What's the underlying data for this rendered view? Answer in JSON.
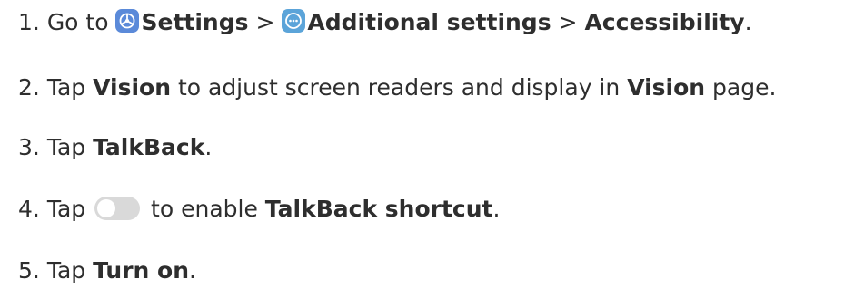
{
  "steps": [
    {
      "number": "1.",
      "parts": {
        "t1": "Go to",
        "settings": "Settings",
        "sep1": ">",
        "additional": "Additional settings",
        "sep2": ">",
        "accessibility": "Accessibility",
        "end": "."
      }
    },
    {
      "number": "2.",
      "parts": {
        "t1": "Tap",
        "vision1": "Vision",
        "t2": "to adjust screen readers and display in",
        "vision2": "Vision",
        "t3": "page."
      }
    },
    {
      "number": "3.",
      "parts": {
        "t1": "Tap",
        "talkback": "TalkBack",
        "end": "."
      }
    },
    {
      "number": "4.",
      "parts": {
        "t1": "Tap",
        "t2": "to enable",
        "shortcut": "TalkBack shortcut",
        "end": "."
      }
    },
    {
      "number": "5.",
      "parts": {
        "t1": "Tap",
        "turnon": "Turn on",
        "end": "."
      }
    }
  ],
  "icons": {
    "settings": {
      "name": "settings-app-icon",
      "color": "#5b8ad9"
    },
    "additional": {
      "name": "additional-settings-app-icon",
      "color": "#5ba4d9"
    },
    "toggle": {
      "name": "toggle-off-icon",
      "state": "off",
      "color": "#d9d9d9"
    }
  },
  "colors": {
    "text": "#2e2e2e",
    "background": "#ffffff"
  }
}
